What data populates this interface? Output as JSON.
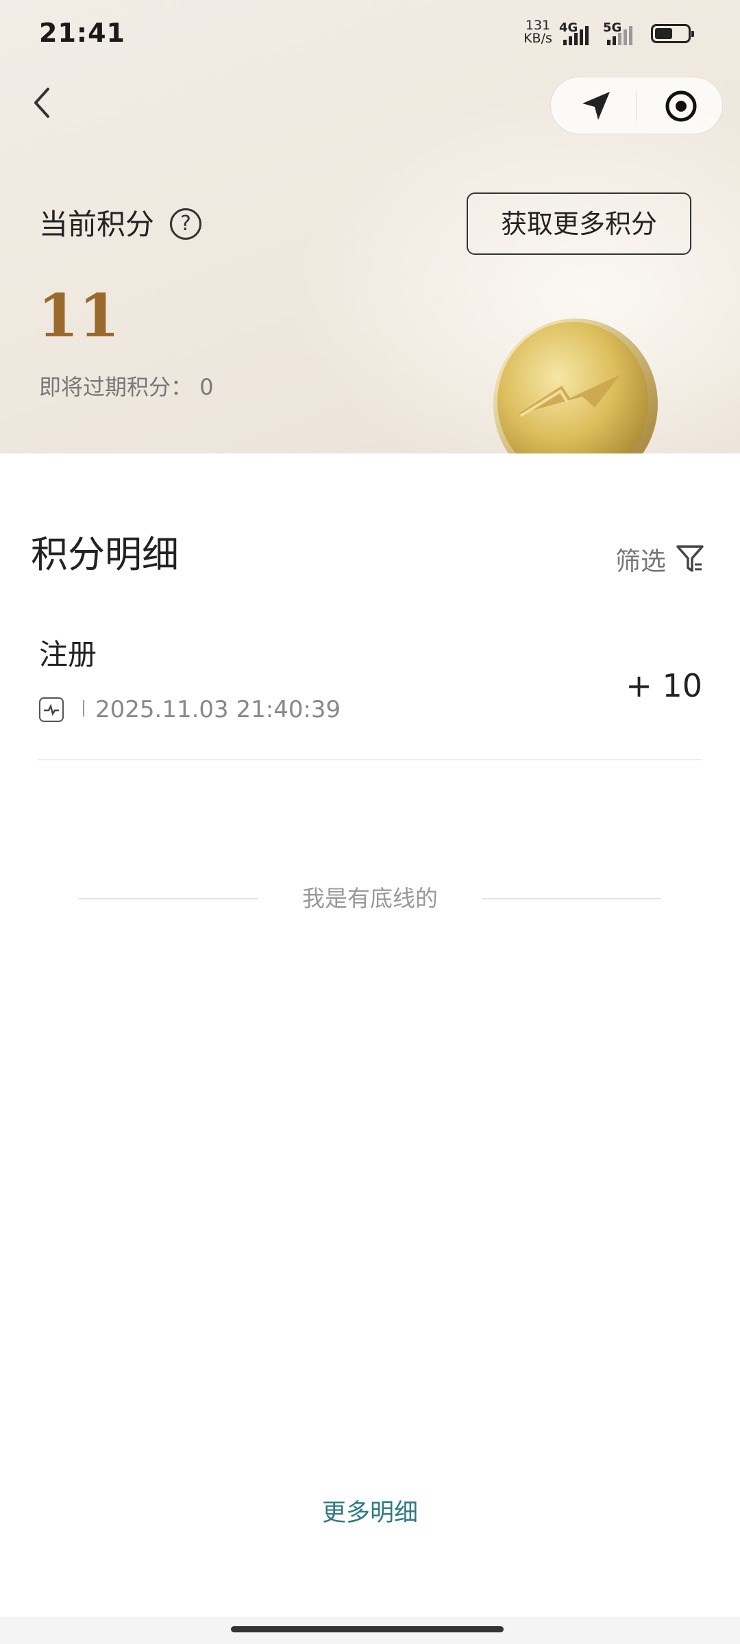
{
  "status_bar": {
    "time": "21:41",
    "net_speed_value": "131",
    "net_speed_unit": "KB/s",
    "signal_1": "4G",
    "signal_2": "5G",
    "battery_level": 0.55
  },
  "nav": {
    "back_icon": "chevron-left-icon",
    "capsule_icons": [
      "location-arrow-icon",
      "target-icon"
    ]
  },
  "points": {
    "label": "当前积分",
    "help_icon": "question-circle-icon",
    "help_glyph": "?",
    "more_points_button": "获取更多积分",
    "value": "11",
    "expire_label": "即将过期积分：",
    "expire_value": "0",
    "accent_color": "#9a6a2c"
  },
  "details": {
    "title": "积分明细",
    "filter_label": "筛选",
    "filter_icon": "filter-icon",
    "records": [
      {
        "title": "注册",
        "icon": "app-activity-icon",
        "time": "2025.11.03 21:40:39",
        "amount": "+ 10"
      }
    ],
    "end_text": "我是有底线的",
    "more_button": "更多明细",
    "link_color": "#2c7b84"
  }
}
